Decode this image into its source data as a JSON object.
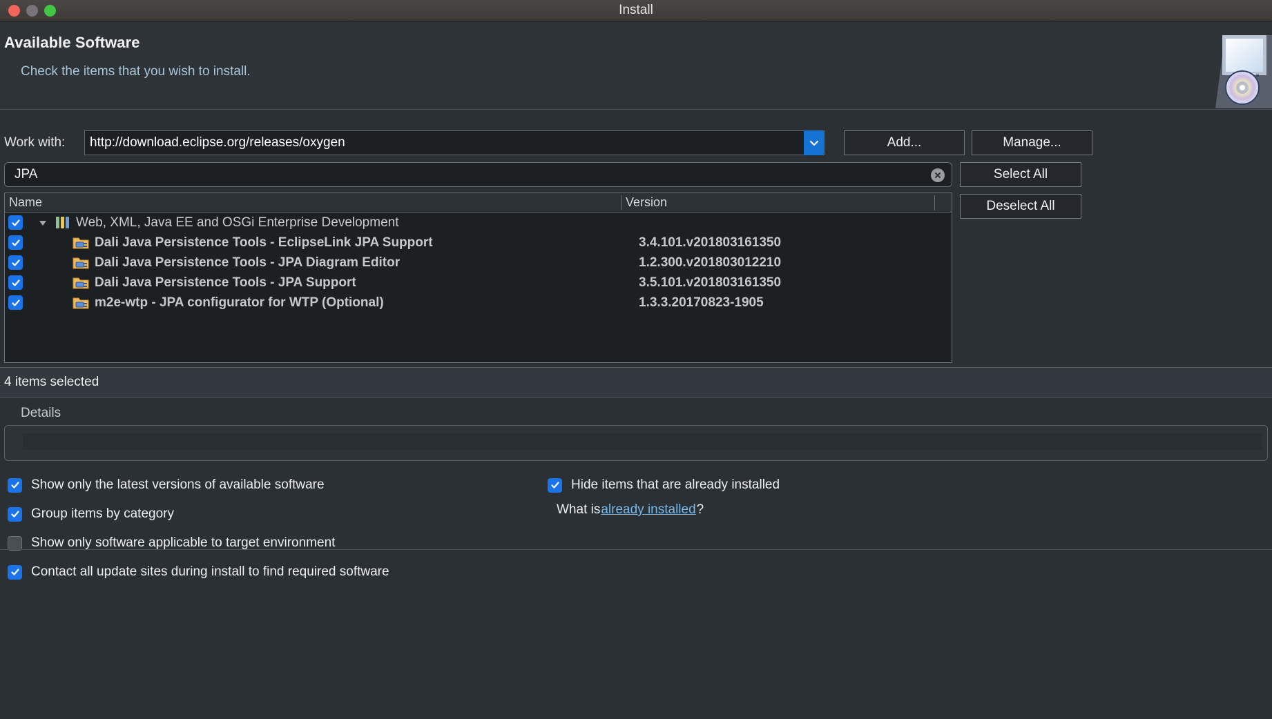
{
  "window": {
    "title": "Install",
    "traffic_lights": [
      "close-button",
      "minimize-button",
      "maximize-button"
    ]
  },
  "header": {
    "title": "Available Software",
    "subtitle": "Check the items that you wish to install.",
    "icon": "install-cd-monitor-icon"
  },
  "work_with": {
    "label": "Work with:",
    "value": "http://download.eclipse.org/releases/oxygen",
    "placeholder": "type or select a site",
    "dropdown_icon": "chevron-down-icon",
    "add_label": "Add...",
    "manage_label": "Manage..."
  },
  "filter": {
    "value": "JPA",
    "placeholder": "type filter text",
    "clear_icon": "clear-circle-icon",
    "select_all_label": "Select All",
    "deselect_all_label": "Deselect All"
  },
  "table": {
    "columns": [
      "Name",
      "Version"
    ],
    "rows": [
      {
        "type": "category",
        "checked": true,
        "expanded": true,
        "icon": "category-bars-icon",
        "name": "Web, XML, Java EE and OSGi Enterprise Development",
        "version": ""
      },
      {
        "type": "feature",
        "checked": true,
        "icon": "feature-plug-icon",
        "name": "Dali Java Persistence Tools - EclipseLink JPA Support",
        "version": "3.4.101.v201803161350"
      },
      {
        "type": "feature",
        "checked": true,
        "icon": "feature-plug-icon",
        "name": "Dali Java Persistence Tools - JPA Diagram Editor",
        "version": "1.2.300.v201803012210"
      },
      {
        "type": "feature",
        "checked": true,
        "icon": "feature-plug-icon",
        "name": "Dali Java Persistence Tools - JPA Support",
        "version": "3.5.101.v201803161350"
      },
      {
        "type": "feature",
        "checked": true,
        "icon": "feature-plug-icon",
        "name": "m2e-wtp - JPA configurator for WTP (Optional)",
        "version": "1.3.3.20170823-1905"
      }
    ]
  },
  "status": {
    "selection_text": "4 items selected"
  },
  "details": {
    "label": "Details"
  },
  "options": {
    "left": [
      {
        "label": "Show only the latest versions of available software",
        "checked": true
      },
      {
        "label": "Group items by category",
        "checked": true
      },
      {
        "label": "Show only software applicable to target environment",
        "checked": false
      },
      {
        "label": "Contact all update sites during install to find required software",
        "checked": true
      }
    ],
    "right": [
      {
        "label": "Hide items that are already installed",
        "checked": true
      }
    ],
    "whatis_prefix": "What is ",
    "whatis_link": "already installed",
    "whatis_suffix": "?"
  },
  "colors": {
    "accent": "#1a73e8",
    "link": "#79b6e8",
    "subtitle": "#a8c6d8",
    "window_bg": "#2b3034",
    "field_bg": "#1c2023"
  }
}
